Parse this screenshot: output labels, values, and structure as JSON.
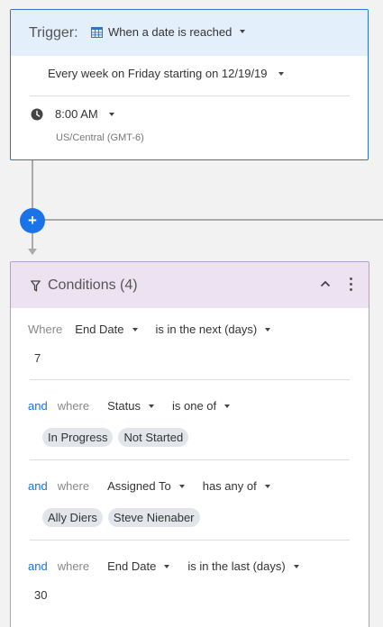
{
  "trigger": {
    "label": "Trigger:",
    "type": "When a date is reached",
    "schedule": "Every week on Friday starting on 12/19/19",
    "time": "8:00 AM",
    "timezone": "US/Central (GMT-6)"
  },
  "conditions": {
    "title": "Conditions (4)",
    "items": [
      {
        "conjunction": "",
        "where": "Where",
        "field": "End Date",
        "operator": "is in the next (days)",
        "value": "7"
      },
      {
        "conjunction": "and",
        "where": "where",
        "field": "Status",
        "operator": "is one of",
        "chips": [
          "In Progress",
          "Not Started"
        ]
      },
      {
        "conjunction": "and",
        "where": "where",
        "field": "Assigned To",
        "operator": "has any of",
        "chips": [
          "Ally Diers",
          "Steve Nienaber"
        ]
      },
      {
        "conjunction": "and",
        "where": "where",
        "field": "End Date",
        "operator": "is in the last (days)",
        "value": "30"
      }
    ]
  },
  "connector": {
    "add_label": "+"
  },
  "colors": {
    "trigger_border": "#2e74c9",
    "trigger_header": "#e3effb",
    "conditions_border": "#b39dcf",
    "conditions_header": "#ede2f2",
    "accent_blue": "#1a73e8"
  },
  "icons": [
    "calendar-icon",
    "clock-icon",
    "filter-icon",
    "chevron-up-icon",
    "more-vert-icon",
    "plus-icon"
  ]
}
